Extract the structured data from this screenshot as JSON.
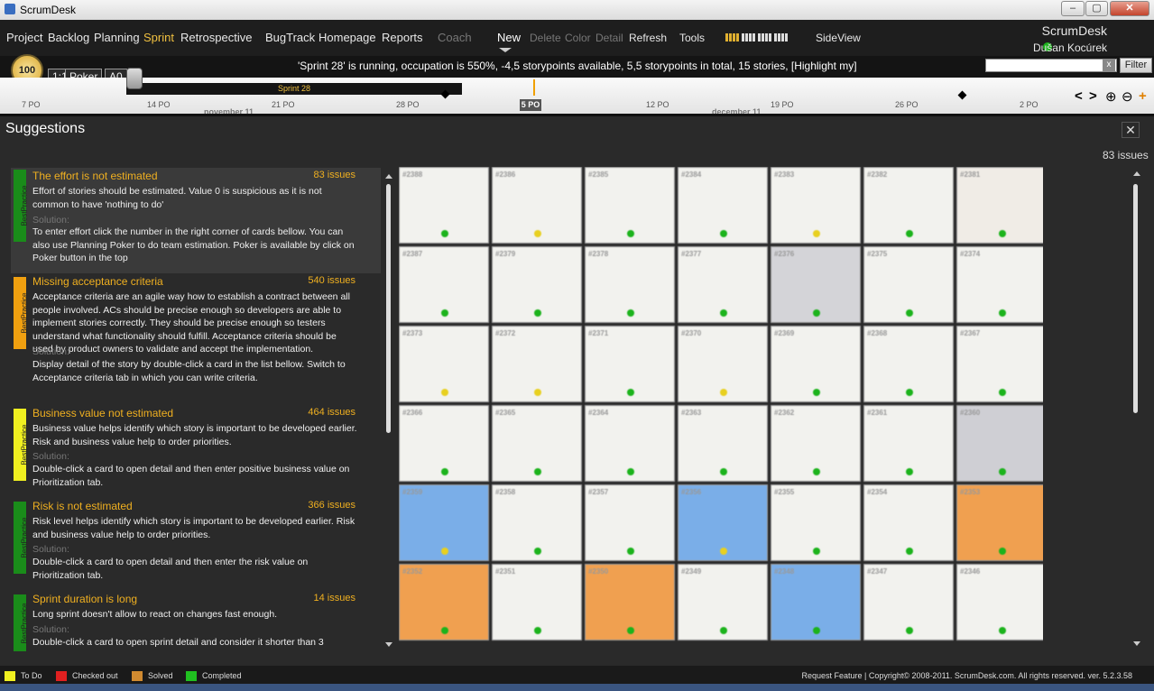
{
  "window": {
    "title": "ScrumDesk",
    "min": "–",
    "max": "▢",
    "close": "✕"
  },
  "menu": {
    "items": [
      {
        "label": "Project",
        "state": "normal"
      },
      {
        "label": "Backlog",
        "state": "normal"
      },
      {
        "label": "Planning",
        "state": "normal"
      },
      {
        "label": "Sprint",
        "state": "active"
      },
      {
        "label": "Retrospective",
        "state": "normal"
      },
      {
        "label": "BugTrack",
        "state": "normal"
      },
      {
        "label": "Homepage",
        "state": "normal"
      },
      {
        "label": "Reports",
        "state": "normal"
      },
      {
        "label": "Coach",
        "state": "dim"
      }
    ],
    "actions": [
      {
        "label": "New",
        "state": "new"
      },
      {
        "label": "Delete",
        "state": "dim"
      },
      {
        "label": "Color",
        "state": "dim"
      },
      {
        "label": "Detail",
        "state": "dim"
      },
      {
        "label": "Refresh",
        "state": "normal"
      },
      {
        "label": "Tools",
        "state": "normal"
      }
    ],
    "sideview": "SideView",
    "brand": "ScrumDesk",
    "user": "Dušan Kocúrek"
  },
  "toolbar": {
    "gauge": "100",
    "btn_1to1": "1:1",
    "btn_poker": "Poker",
    "btn_a0": "A0",
    "status": "'Sprint 28' is running, occupation is 550%, -4,5 storypoints available, 5,5 storypoints in total,  15 stories, [Highlight my]",
    "search_clear": "x",
    "filter": "Filter"
  },
  "timeline": {
    "sprint": "Sprint 28",
    "ticks": [
      "7 PO",
      "14 PO",
      "21 PO",
      "28 PO",
      "12 PO",
      "19 PO",
      "26 PO",
      "2 PO"
    ],
    "today": "5 PO",
    "months": [
      "november 11",
      "december 11"
    ],
    "nav": [
      "<",
      ">",
      "⊕",
      "⊖",
      "+"
    ]
  },
  "suggestions": {
    "title": "Suggestions",
    "close": "✕",
    "issue_count": "83 issues",
    "solution_label": "Solution:",
    "items": [
      {
        "tag": "BestPractice",
        "color": "#1a8c1a",
        "title": "The effort is not estimated",
        "count": "83 issues",
        "desc": "Effort of stories should be estimated. Value 0 is suspicious as it is not common to have 'nothing to do'",
        "solution": "To enter effort click the number in the right corner of cards bellow. You can also use Planning Poker to do team estimation. Poker is available by click on Poker button in the top"
      },
      {
        "tag": "BestPractice",
        "color": "#f0a010",
        "title": "Missing acceptance criteria",
        "count": "540 issues",
        "desc": "Acceptance criteria are an agile way how to establish a contract between all people involved. ACs should be precise enough so developers are able to implement stories correctly. They should be precise enough so testers understand what functionality should fulfill. Acceptance criteria should be used by product owners to validate and accept the implementation.",
        "solution": "Display detail of the story by double-click a card in the list bellow. Switch to Acceptance criteria tab in which you can write criteria."
      },
      {
        "tag": "BestPractice",
        "color": "#f0f020",
        "title": "Business value not estimated",
        "count": "464 issues",
        "desc": "Business value helps identify which story is important to be developed earlier. Risk and business value help to order priorities.",
        "solution": "Double-click a card to open detail and then enter positive business value on Prioritization tab."
      },
      {
        "tag": "BestPractice",
        "color": "#1a8c1a",
        "title": "Risk is not estimated",
        "count": "366 issues",
        "desc": "Risk level helps identify which story is important to be developed earlier. Risk and business value help to order priorities.",
        "solution": "Double-click a card to open detail and then enter the risk value on Prioritization tab."
      },
      {
        "tag": "BestPractice",
        "color": "#1a8c1a",
        "title": "Sprint duration is long",
        "count": "14 issues",
        "desc": "Long sprint doesn't allow to react on changes fast enough.",
        "solution": "Double-click a card to open sprint detail and consider it shorter than 3"
      }
    ]
  },
  "cards": [
    {
      "id": "#2388",
      "color": "#f2f2ee",
      "dot": "g"
    },
    {
      "id": "#2386",
      "color": "#f2f2ee",
      "dot": "y"
    },
    {
      "id": "#2385",
      "color": "#f2f2ee",
      "dot": "g"
    },
    {
      "id": "#2384",
      "color": "#f2f2ee",
      "dot": "g"
    },
    {
      "id": "#2383",
      "color": "#f2f2ee",
      "dot": "y"
    },
    {
      "id": "#2382",
      "color": "#f2f2ee",
      "dot": "g"
    },
    {
      "id": "#2381",
      "color": "#f0ece6",
      "dot": "g"
    },
    {
      "id": "#2387",
      "color": "#f2f2ee",
      "dot": "g"
    },
    {
      "id": "#2379",
      "color": "#f2f2ee",
      "dot": "g"
    },
    {
      "id": "#2378",
      "color": "#f2f2ee",
      "dot": "g"
    },
    {
      "id": "#2377",
      "color": "#f2f2ee",
      "dot": "g"
    },
    {
      "id": "#2376",
      "color": "#d4d4d8",
      "dot": "g"
    },
    {
      "id": "#2375",
      "color": "#f2f2ee",
      "dot": "g"
    },
    {
      "id": "#2374",
      "color": "#f2f2ee",
      "dot": "g"
    },
    {
      "id": "#2373",
      "color": "#f2f2ee",
      "dot": "y"
    },
    {
      "id": "#2372",
      "color": "#f2f2ee",
      "dot": "y"
    },
    {
      "id": "#2371",
      "color": "#f2f2ee",
      "dot": "g"
    },
    {
      "id": "#2370",
      "color": "#f2f2ee",
      "dot": "y"
    },
    {
      "id": "#2369",
      "color": "#f2f2ee",
      "dot": "g"
    },
    {
      "id": "#2368",
      "color": "#f2f2ee",
      "dot": "g"
    },
    {
      "id": "#2367",
      "color": "#f2f2ee",
      "dot": "g"
    },
    {
      "id": "#2366",
      "color": "#f2f2ee",
      "dot": "g"
    },
    {
      "id": "#2365",
      "color": "#f2f2ee",
      "dot": "g"
    },
    {
      "id": "#2364",
      "color": "#f2f2ee",
      "dot": "g"
    },
    {
      "id": "#2363",
      "color": "#f2f2ee",
      "dot": "g"
    },
    {
      "id": "#2362",
      "color": "#f2f2ee",
      "dot": "g"
    },
    {
      "id": "#2361",
      "color": "#f2f2ee",
      "dot": "g"
    },
    {
      "id": "#2360",
      "color": "#cfcfd4",
      "dot": "g"
    },
    {
      "id": "#2359",
      "color": "#7aaee8",
      "dot": "y"
    },
    {
      "id": "#2358",
      "color": "#f2f2ee",
      "dot": "g"
    },
    {
      "id": "#2357",
      "color": "#f2f2ee",
      "dot": "g"
    },
    {
      "id": "#2356",
      "color": "#7aaee8",
      "dot": "y"
    },
    {
      "id": "#2355",
      "color": "#f2f2ee",
      "dot": "g"
    },
    {
      "id": "#2354",
      "color": "#f2f2ee",
      "dot": "g"
    },
    {
      "id": "#2353",
      "color": "#f0a050",
      "dot": "g"
    },
    {
      "id": "#2352",
      "color": "#f0a050",
      "dot": "g"
    },
    {
      "id": "#2351",
      "color": "#f2f2ee",
      "dot": "g"
    },
    {
      "id": "#2350",
      "color": "#f0a050",
      "dot": "g"
    },
    {
      "id": "#2349",
      "color": "#f2f2ee",
      "dot": "g"
    },
    {
      "id": "#2348",
      "color": "#7aaee8",
      "dot": "g"
    },
    {
      "id": "#2347",
      "color": "#f2f2ee",
      "dot": "g"
    },
    {
      "id": "#2346",
      "color": "#f2f2ee",
      "dot": "g"
    }
  ],
  "footer": {
    "legend": [
      {
        "label": "To Do",
        "color": "#f0f020"
      },
      {
        "label": "Checked out",
        "color": "#e02020"
      },
      {
        "label": "Solved",
        "color": "#d08a30"
      },
      {
        "label": "Completed",
        "color": "#20c020"
      }
    ],
    "copyright": "Request Feature | Copyright© 2008-2011. ScrumDesk.com. All rights reserved. ver. 5.2.3.58"
  }
}
